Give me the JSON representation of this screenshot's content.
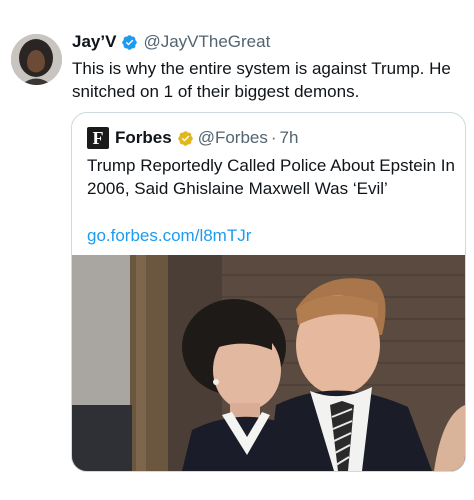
{
  "tweet": {
    "author_name": "Jay’V",
    "author_handle": "@JayVTheGreat",
    "text": "This is why the entire system is against Trump. He snitched on 1 of their biggest demons.",
    "avatar_icon": "user-avatar-photo",
    "verified_icon": "verified-badge-icon",
    "verified_color": "#1d9bf0"
  },
  "quote": {
    "logo_letter": "F",
    "author_name": "Forbes",
    "author_handle": "@Forbes",
    "separator": "·",
    "time": "7h",
    "verified_icon": "gold-verified-badge-icon",
    "verified_color": "#e2b719",
    "text": "Trump Reportedly Called Police About Epstein In 2006, Said Ghislaine Maxwell Was ‘Evil’",
    "link": "go.forbes.com/l8mTJr",
    "link_color": "#1d9bf0",
    "image_icon": "news-photo"
  }
}
